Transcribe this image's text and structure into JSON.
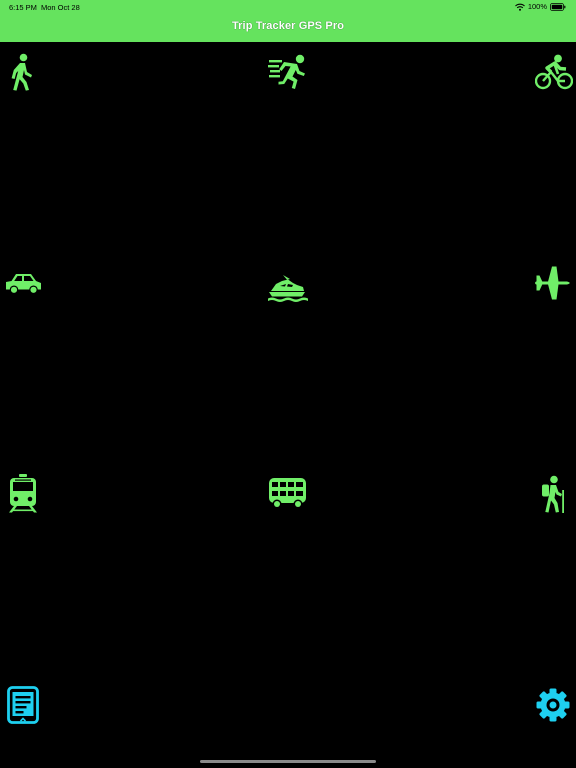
{
  "status_bar": {
    "time": "6:15 PM",
    "date": "Mon Oct 28",
    "battery": "100%"
  },
  "header": {
    "title": "Trip Tracker GPS Pro"
  },
  "colors": {
    "accent_green": "#65e35e",
    "icon_green": "#70ee68",
    "accent_cyan": "#1ed0f0",
    "background": "#000000"
  },
  "modes": [
    {
      "name": "walk",
      "icon": "walking-icon"
    },
    {
      "name": "run",
      "icon": "running-icon"
    },
    {
      "name": "bike",
      "icon": "bicycle-icon"
    },
    {
      "name": "car",
      "icon": "car-icon"
    },
    {
      "name": "boat",
      "icon": "boat-icon"
    },
    {
      "name": "plane",
      "icon": "airplane-icon"
    },
    {
      "name": "train",
      "icon": "train-icon"
    },
    {
      "name": "bus",
      "icon": "bus-icon"
    },
    {
      "name": "hike",
      "icon": "hiking-icon"
    }
  ],
  "bottom_bar": {
    "left_icon": "trip-log-icon",
    "right_icon": "settings-gear-icon"
  }
}
